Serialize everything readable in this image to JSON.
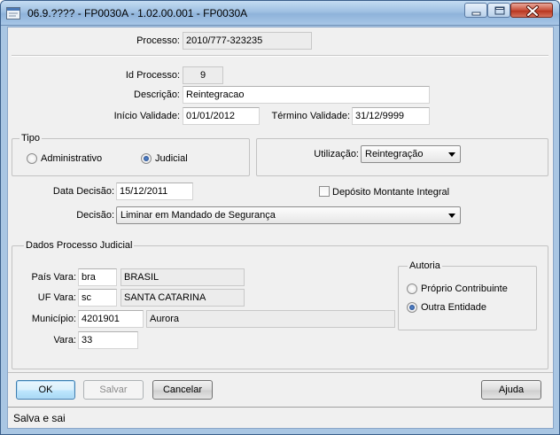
{
  "window": {
    "title": "06.9.???? - FP0030A - 1.02.00.001 - FP0030A"
  },
  "form": {
    "processo": {
      "label": "Processo:",
      "value": "2010/777-323235"
    },
    "id_processo": {
      "label": "Id Processo:",
      "value": "9"
    },
    "descricao": {
      "label": "Descrição:",
      "value": "Reintegracao"
    },
    "inicio_validade": {
      "label": "Início Validade:",
      "value": "01/01/2012"
    },
    "termino_validade": {
      "label": "Término Validade:",
      "value": "31/12/9999"
    },
    "tipo": {
      "title": "Tipo",
      "options": [
        {
          "label": "Administrativo",
          "selected": false
        },
        {
          "label": "Judicial",
          "selected": true
        }
      ]
    },
    "utilizacao": {
      "label": "Utilização:",
      "value": "Reintegração"
    },
    "data_decisao": {
      "label": "Data Decisão:",
      "value": "15/12/2011"
    },
    "deposito": {
      "label": "Depósito Montante Integral",
      "checked": false
    },
    "decisao": {
      "label": "Decisão:",
      "value": "Liminar em Mandado de Segurança"
    }
  },
  "judicial": {
    "title": "Dados Processo Judicial",
    "pais_vara": {
      "label": "País Vara:",
      "code": "bra",
      "name": "BRASIL"
    },
    "uf_vara": {
      "label": "UF Vara:",
      "code": "sc",
      "name": "SANTA CATARINA"
    },
    "municipio": {
      "label": "Município:",
      "code": "4201901",
      "name": "Aurora"
    },
    "vara": {
      "label": "Vara:",
      "value": "33"
    },
    "autoria": {
      "title": "Autoria",
      "options": [
        {
          "label": "Próprio Contribuinte",
          "selected": false
        },
        {
          "label": "Outra Entidade",
          "selected": true
        }
      ]
    }
  },
  "buttons": {
    "ok": "OK",
    "salvar": "Salvar",
    "cancelar": "Cancelar",
    "ajuda": "Ajuda"
  },
  "status": {
    "text": "Salva e sai"
  },
  "colors": {
    "titlebar": "#9fc0e2",
    "client": "#f0f0f0",
    "close_button": "#c8503b"
  }
}
